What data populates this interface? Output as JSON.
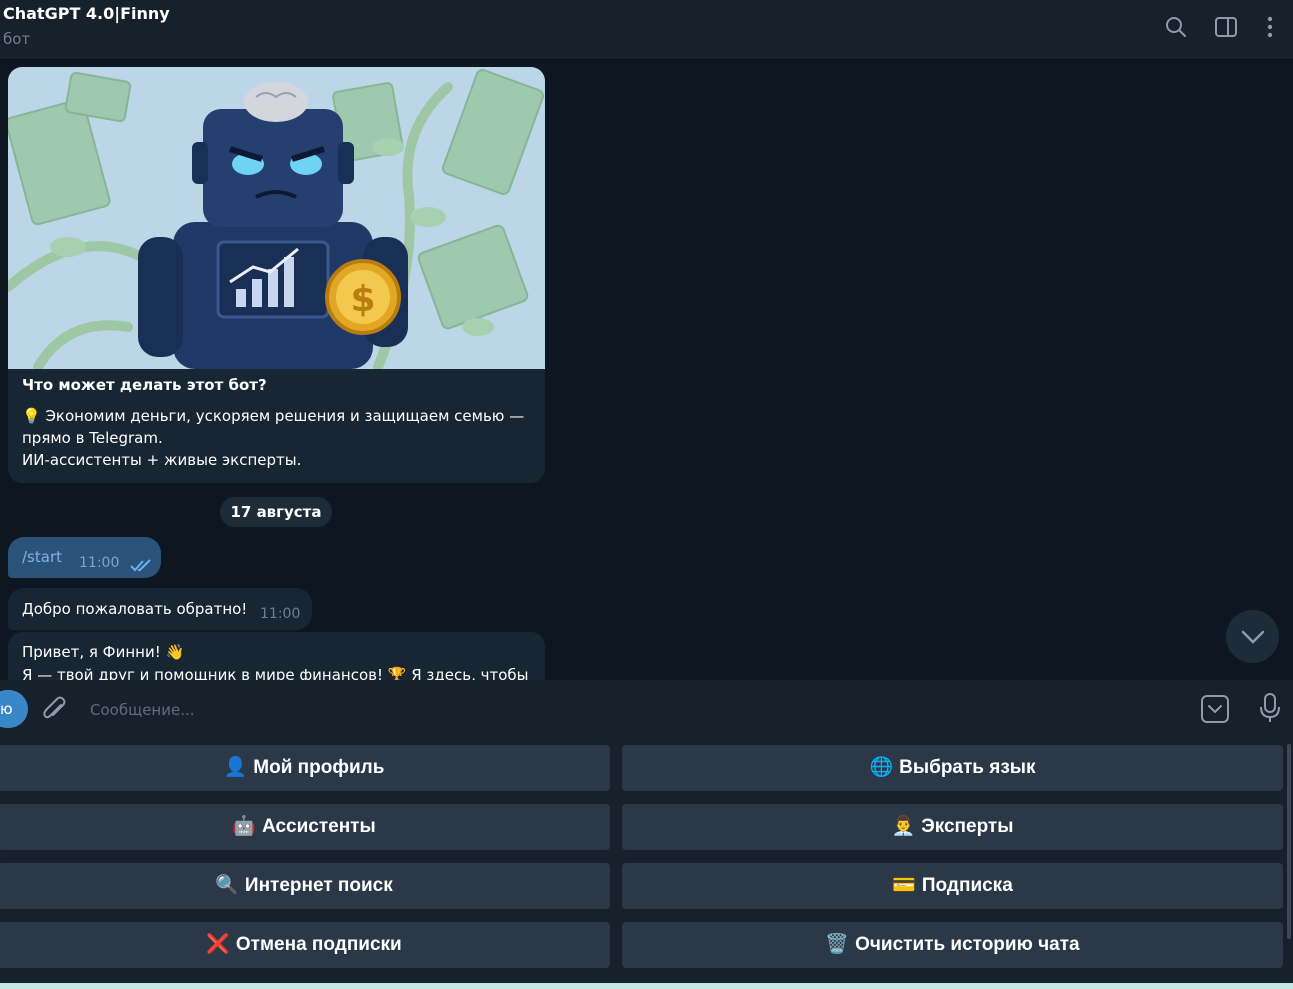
{
  "header": {
    "title": "ChatGPT 4.0|Finny",
    "subtitle": "бот",
    "icons": [
      "search-icon",
      "sidebar-toggle-icon",
      "more-vertical-icon"
    ]
  },
  "bot_info": {
    "image": "robot-with-coin-illustration",
    "title": "Что может делать этот бот?",
    "text": "💡 Экономим деньги, ускоряем решения и защищаем семью — прямо в Telegram.\n ИИ-ассистенты + живые эксперты."
  },
  "date_separator": "17 августа",
  "messages": {
    "outgoing": {
      "text": "/start",
      "time": "11:00",
      "status_icon": "double-check-icon"
    },
    "incoming": {
      "text": "Добро пожаловать обратно!",
      "time": "11:00"
    },
    "incoming2": {
      "line1": "Привет, я Финни! 👋",
      "line2": "Я — твой друг и помощник в мире финансов! 🏆 Я здесь, чтобы"
    }
  },
  "input": {
    "menu_label": "ю",
    "placeholder": "Сообщение...",
    "icons": [
      "attach-icon",
      "keyboard-toggle-icon",
      "microphone-icon"
    ]
  },
  "keyboard": {
    "buttons": [
      {
        "emoji": "👤",
        "label": "Мой профиль"
      },
      {
        "emoji": "🌐",
        "label": "Выбрать язык"
      },
      {
        "emoji": "🤖",
        "label": "Ассистенты"
      },
      {
        "emoji": "👨‍💼",
        "label": "Эксперты"
      },
      {
        "emoji": "🔍",
        "label": "Интернет поиск"
      },
      {
        "emoji": "💳",
        "label": "Подписка"
      },
      {
        "emoji": "❌",
        "label": "Отмена подписки"
      },
      {
        "emoji": "🗑️",
        "label": "Очистить историю чата"
      }
    ]
  }
}
